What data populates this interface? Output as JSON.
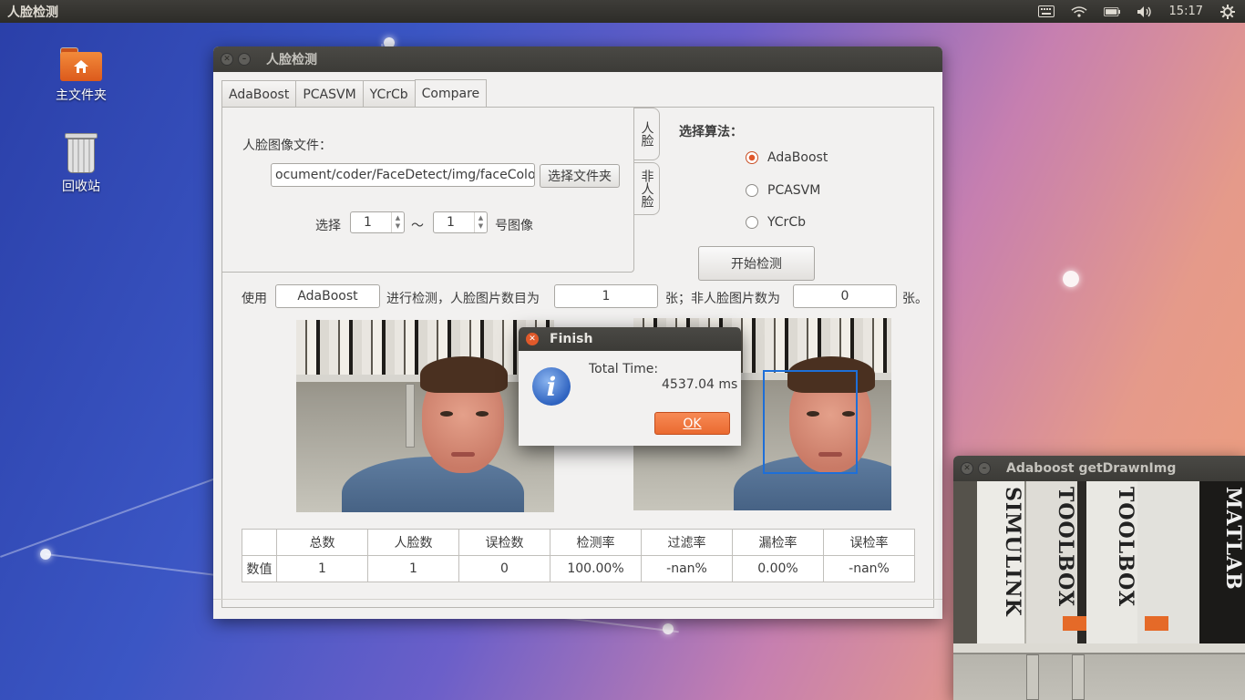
{
  "top_panel": {
    "app_title": "人脸检测",
    "time": "15:17",
    "tray_icons": [
      "keyboard-icon",
      "wifi-icon",
      "battery-icon",
      "volume-icon",
      "settings-gear-icon"
    ]
  },
  "desktop": {
    "icons": [
      {
        "label": "主文件夹",
        "icon": "home-folder-icon"
      },
      {
        "label": "回收站",
        "icon": "trash-icon"
      }
    ]
  },
  "main_window": {
    "title": "人脸检测",
    "tabs": [
      {
        "label": "AdaBoost",
        "active": false
      },
      {
        "label": "PCASVM",
        "active": false
      },
      {
        "label": "YCrCb",
        "active": false
      },
      {
        "label": "Compare",
        "active": true
      }
    ],
    "face_image_file_label": "人脸图像文件：",
    "file_path": "ocument/coder/FaceDetect/img/faceColor",
    "choose_folder_button": "选择文件夹",
    "select_label": "选择",
    "range_from": "1",
    "range_tilde": "～",
    "range_to": "1",
    "image_suffix_label": "号图像",
    "side_tabs": [
      "人脸",
      "非人脸"
    ],
    "algorithm_label": "选择算法：",
    "algorithms": [
      {
        "label": "AdaBoost",
        "checked": true
      },
      {
        "label": "PCASVM",
        "checked": false
      },
      {
        "label": "YCrCb",
        "checked": false
      }
    ],
    "start_button": "开始检测",
    "summary": {
      "use_label": "使用",
      "algorithm_value": "AdaBoost",
      "detect_label": "进行检测，人脸图片数目为",
      "face_count": "1",
      "nonface_label": "张；非人脸图片数为",
      "nonface_count": "0",
      "unit_label": "张。"
    },
    "stats_table": {
      "headers": [
        "",
        "总数",
        "人脸数",
        "误检数",
        "检测率",
        "过滤率",
        "漏检率",
        "误检率"
      ],
      "row_label": "数值",
      "values": [
        "1",
        "1",
        "0",
        "100.00%",
        "-nan%",
        "0.00%",
        "-nan%"
      ]
    }
  },
  "finish_dialog": {
    "title": "Finish",
    "total_time_label": "Total Time:",
    "total_time_value": "4537.04 ms",
    "ok_button": "OK"
  },
  "second_window": {
    "title": "Adaboost getDrawnImg",
    "book_spines": [
      "SIMULINK",
      "TOOLBOX",
      "TOOLBOX",
      "MATLAB"
    ]
  }
}
